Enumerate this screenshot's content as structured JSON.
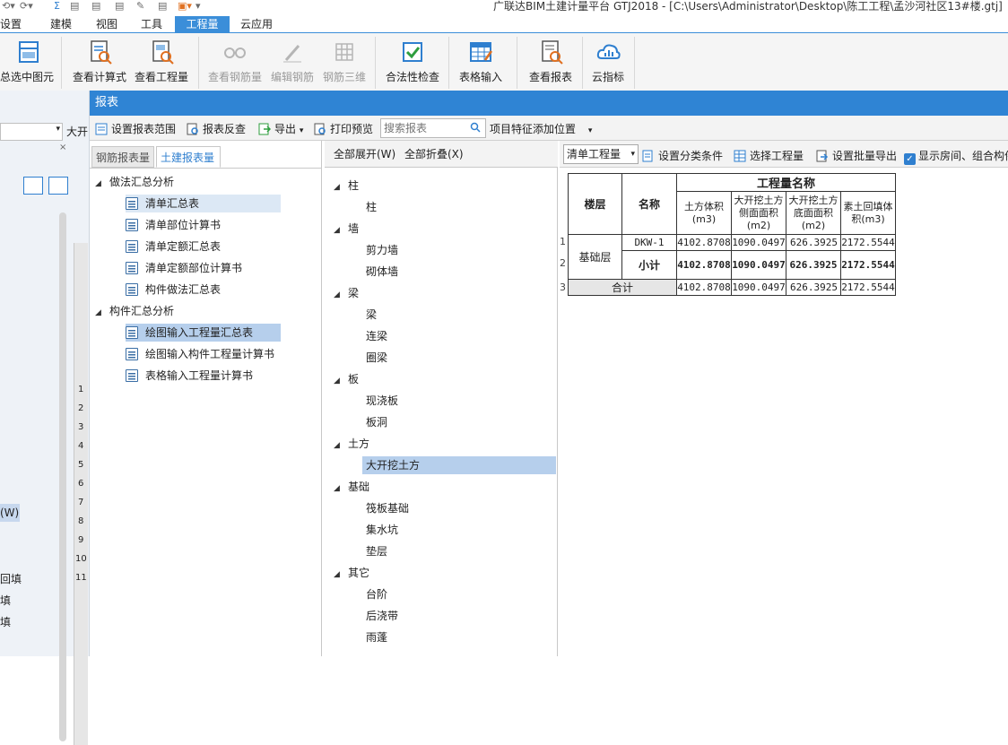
{
  "app_title": "广联达BIM土建计量平台 GTJ2018 - [C:\\Users\\Administrator\\Desktop\\陈工工程\\孟沙河社区13#楼.gtj]",
  "menu": [
    "设置",
    "建模",
    "视图",
    "工具",
    "工程量",
    "云应用"
  ],
  "menu_active": "工程量",
  "ribbon": {
    "select_all": "总选中图元",
    "view_formula": "查看计算式",
    "view_quantity": "查看工程量",
    "view_rebar": "查看钢筋量",
    "edit_rebar": "编辑钢筋",
    "rebar_3d": "钢筋三维",
    "legality_check": "合法性检查",
    "table_input": "表格输入",
    "view_report": "查看报表",
    "cloud_index": "云指标"
  },
  "dialog": {
    "title": "报表",
    "toolbar": {
      "set_range": "设置报表范围",
      "reverse_check": "报表反查",
      "export": "导出",
      "print_preview": "打印预览",
      "search_placeholder": "搜索报表",
      "feature_position": "项目特征添加位置"
    }
  },
  "left_pane": {
    "tabs": [
      "钢筋报表量",
      "土建报表量"
    ],
    "groups": [
      {
        "label": "做法汇总分析",
        "items": [
          "清单汇总表",
          "清单部位计算书",
          "清单定额汇总表",
          "清单定额部位计算书",
          "构件做法汇总表"
        ]
      },
      {
        "label": "构件汇总分析",
        "items": [
          "绘图输入工程量汇总表",
          "绘图输入构件工程量计算书",
          "表格输入工程量计算书"
        ]
      }
    ]
  },
  "mid_pane": {
    "expand_all": "全部展开(W)",
    "collapse_all": "全部折叠(X)",
    "groups": [
      {
        "label": "柱",
        "items": [
          "柱"
        ]
      },
      {
        "label": "墙",
        "items": [
          "剪力墙",
          "砌体墙"
        ]
      },
      {
        "label": "梁",
        "items": [
          "梁",
          "连梁",
          "圈梁"
        ]
      },
      {
        "label": "板",
        "items": [
          "现浇板",
          "板洞"
        ]
      },
      {
        "label": "土方",
        "items": [
          "大开挖土方"
        ]
      },
      {
        "label": "基础",
        "items": [
          "筏板基础",
          "集水坑",
          "垫层"
        ]
      },
      {
        "label": "其它",
        "items": [
          "台阶",
          "后浇带",
          "雨蓬"
        ]
      }
    ]
  },
  "right_pane": {
    "select_value": "清单工程量",
    "set_category": "设置分类条件",
    "select_quantity": "选择工程量",
    "batch_export": "设置批量导出",
    "show_room": "显示房间、组合构件",
    "table": {
      "group_header": "工程量名称",
      "col_floor": "楼层",
      "col_name": "名称",
      "cols": [
        "土方体积(m3)",
        "大开挖土方侧面面积(m2)",
        "大开挖土方底面面积(m2)",
        "素土回填体积(m3)"
      ],
      "floor": "基础层",
      "rows": [
        {
          "num": "1",
          "name": "DKW-1",
          "values": [
            "4102.8708",
            "1090.0497",
            "626.3925",
            "2172.5544"
          ]
        },
        {
          "num": "2",
          "name": "小计",
          "values": [
            "4102.8708",
            "1090.0497",
            "626.3925",
            "2172.5544"
          ]
        },
        {
          "num": "3",
          "name": "合计",
          "values": [
            "4102.8708",
            "1090.0497",
            "626.3925",
            "2172.5544"
          ]
        }
      ]
    }
  },
  "left_bg": {
    "tab_label": "大开",
    "row_numbers": [
      "1",
      "2",
      "3",
      "4",
      "5",
      "6",
      "7",
      "8",
      "9",
      "10",
      "11"
    ],
    "labels": [
      "(W)",
      "回填",
      "填",
      "填"
    ]
  }
}
